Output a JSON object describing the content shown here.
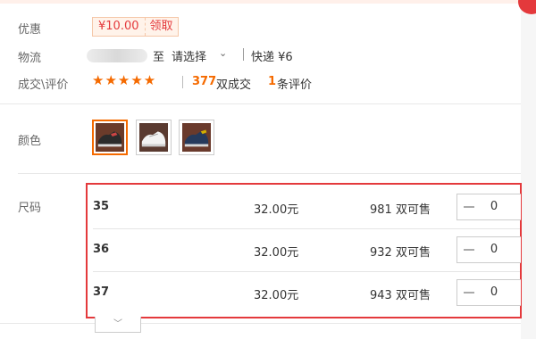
{
  "colors": {
    "accent": "#f56a00",
    "highlight_border": "#e4393c"
  },
  "promo": {
    "label": "优惠",
    "coupon_price": "¥10.00",
    "coupon_action": "领取"
  },
  "shipping": {
    "label": "物流",
    "to": "至",
    "select": "请选择",
    "select_icon": "chevron-down-icon",
    "express": "快递 ¥6"
  },
  "deals": {
    "label": "成交\\评价",
    "rating": 5,
    "stars": "★★★★★",
    "sold_count": "377",
    "sold_text": "双成交",
    "review_count": "1",
    "review_text": "条评价"
  },
  "color": {
    "label": "颜色",
    "swatches": [
      {
        "name": "black-shoe",
        "selected": true
      },
      {
        "name": "white-shoe",
        "selected": false
      },
      {
        "name": "blue-shoe",
        "selected": false
      }
    ]
  },
  "size": {
    "label": "尺码",
    "rows": [
      {
        "name": "35",
        "price": "32.00元",
        "stock": "981 双可售",
        "qty": "0"
      },
      {
        "name": "36",
        "price": "32.00元",
        "stock": "932 双可售",
        "qty": "0"
      },
      {
        "name": "37",
        "price": "32.00元",
        "stock": "943 双可售",
        "qty": "0"
      }
    ]
  },
  "more": {
    "icon": "chevron-down-icon",
    "glyph": "﹀"
  }
}
